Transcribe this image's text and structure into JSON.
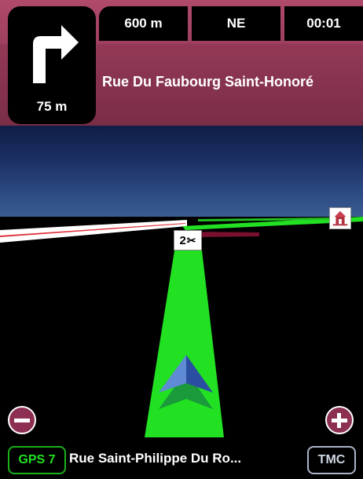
{
  "banner": {
    "turn": {
      "direction": "right",
      "icon": "turn-right-arrow-icon",
      "distance": "75 m"
    },
    "stats": {
      "distance_to_destination": "600 m",
      "heading": "NE",
      "time_remaining": "00:01"
    },
    "next_street": "Rue Du Faubourg Saint-Honoré"
  },
  "map": {
    "maneuver_marker": {
      "number": "2",
      "icon": "scissors-icon"
    },
    "poi_icon": "building-poi-icon",
    "vehicle_icon": "position-arrow-icon"
  },
  "controls": {
    "zoom_out_icon": "minus-icon",
    "zoom_in_icon": "plus-icon"
  },
  "bottom_bar": {
    "gps_label": "GPS 7",
    "current_street": "Rue Saint-Philippe Du Ro...",
    "tmc_label": "TMC"
  },
  "colors": {
    "banner": "#8f3754",
    "route": "#22e022",
    "gps": "#22e022",
    "road_white": "#ffffff",
    "road_red": "#e0303a"
  }
}
